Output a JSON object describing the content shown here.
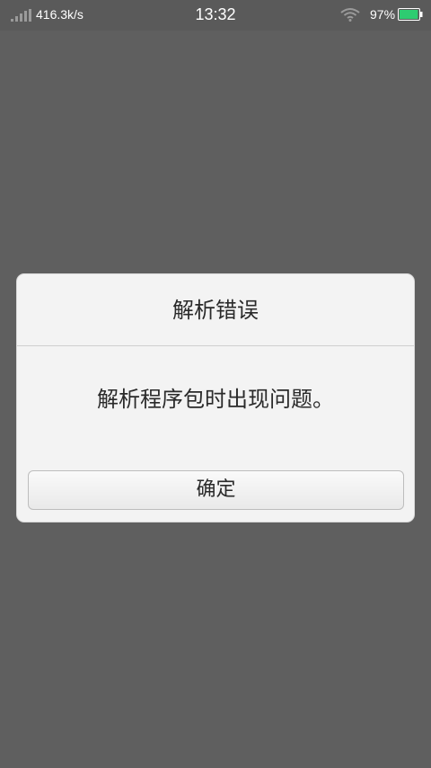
{
  "status_bar": {
    "net_speed": "416.3k/s",
    "time": "13:32",
    "battery_percent": "97%",
    "battery_level": 0.97,
    "battery_color": "#2ecc71",
    "icons": [
      "signal-icon",
      "wifi-icon",
      "battery-icon"
    ]
  },
  "dialog": {
    "title": "解析错误",
    "message": "解析程序包时出现问题。",
    "ok_label": "确定"
  },
  "colors": {
    "overlay": "#5f5f5f",
    "dialog_bg": "#f3f3f3",
    "text": "#2a2a2a"
  }
}
